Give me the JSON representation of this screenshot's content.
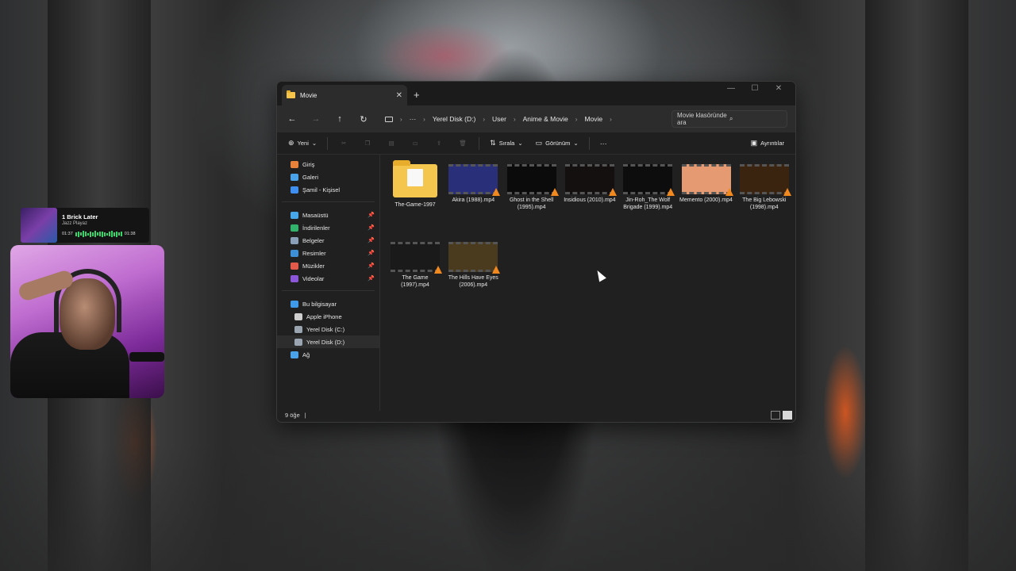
{
  "music": {
    "track": "1 Brick Later",
    "artist": "Jazz Playaz",
    "time_elapsed": "01:37",
    "time_total": "01:38"
  },
  "window": {
    "tab_title": "Movie",
    "new_tab_label": "+",
    "close_tab_label": "✕",
    "controls": {
      "minimize": "—",
      "maximize": "☐",
      "close": "✕"
    }
  },
  "nav": {
    "back": "←",
    "forward": "→",
    "up": "↑",
    "refresh": "↻",
    "more": "···",
    "breadcrumb": [
      "Yerel Disk (D:)",
      "User",
      "Anime & Movie",
      "Movie"
    ],
    "sep": "›",
    "search_placeholder": "Movie klasöründe ara",
    "search_glyph": "⌕"
  },
  "toolbar": {
    "new_label": "Yeni",
    "sort_label": "Sırala",
    "view_label": "Görünüm",
    "more_label": "···",
    "details_label": "Ayrıntılar",
    "chevron": "⌄",
    "icons": [
      "scissors-icon",
      "copy-icon",
      "paste-icon",
      "rename-icon",
      "share-icon",
      "delete-icon"
    ]
  },
  "sidebar": {
    "quick": [
      {
        "label": "Giriş",
        "icon": "home-icon",
        "color": "#e8823a"
      },
      {
        "label": "Galeri",
        "icon": "gallery-icon",
        "color": "#4aa3e8"
      },
      {
        "label": "Şamil - Kişisel",
        "icon": "cloud-icon",
        "color": "#3f8ff0"
      }
    ],
    "pinned": [
      {
        "label": "Masaüstü",
        "icon": "desktop-icon",
        "color": "#47a7e8"
      },
      {
        "label": "İndirilenler",
        "icon": "download-icon",
        "color": "#33b26b"
      },
      {
        "label": "Belgeler",
        "icon": "documents-icon",
        "color": "#8aa0b8"
      },
      {
        "label": "Resimler",
        "icon": "pictures-icon",
        "color": "#3d8fd6"
      },
      {
        "label": "Müzikler",
        "icon": "music-icon",
        "color": "#e45a4a"
      },
      {
        "label": "Videolar",
        "icon": "videos-icon",
        "color": "#8b57d8"
      }
    ],
    "pin_glyph": "📌",
    "computer": [
      {
        "label": "Bu bilgisayar",
        "icon": "computer-icon",
        "color": "#3f9bea",
        "indent": false
      },
      {
        "label": "Apple iPhone",
        "icon": "phone-icon",
        "color": "#cfcfcf",
        "indent": true
      },
      {
        "label": "Yerel Disk (C:)",
        "icon": "drive-icon",
        "color": "#9aa5b1",
        "indent": true
      },
      {
        "label": "Yerel Disk (D:)",
        "icon": "drive-icon",
        "color": "#9aa5b1",
        "indent": true,
        "selected": true
      },
      {
        "label": "Ağ",
        "icon": "network-icon",
        "color": "#4aa3e8",
        "indent": false
      }
    ]
  },
  "files": [
    {
      "name": "The-Game-1997",
      "type": "folder"
    },
    {
      "name": "Akira (1988).mp4",
      "type": "video",
      "thumb": "#2a2f7a"
    },
    {
      "name": "Ghost in the Shell (1995).mp4",
      "type": "video",
      "thumb": "#0b0b0b"
    },
    {
      "name": "Insidious (2010).mp4",
      "type": "video",
      "thumb": "#151010"
    },
    {
      "name": "Jin-Roh_The Wolf Brigade (1999).mp4",
      "type": "video",
      "thumb": "#0d0d0d"
    },
    {
      "name": "Memento (2000).mp4",
      "type": "video",
      "thumb": "#e59a72"
    },
    {
      "name": "The Big Lebowski (1998).mp4",
      "type": "video",
      "thumb": "#3a2410"
    },
    {
      "name": "The Game (1997).mp4",
      "type": "video",
      "thumb": "#1a1a1a"
    },
    {
      "name": "The Hills Have Eyes (2006).mp4",
      "type": "video",
      "thumb": "#4a3a1e"
    }
  ],
  "status": {
    "count": "9 öğe",
    "caret": "|"
  }
}
